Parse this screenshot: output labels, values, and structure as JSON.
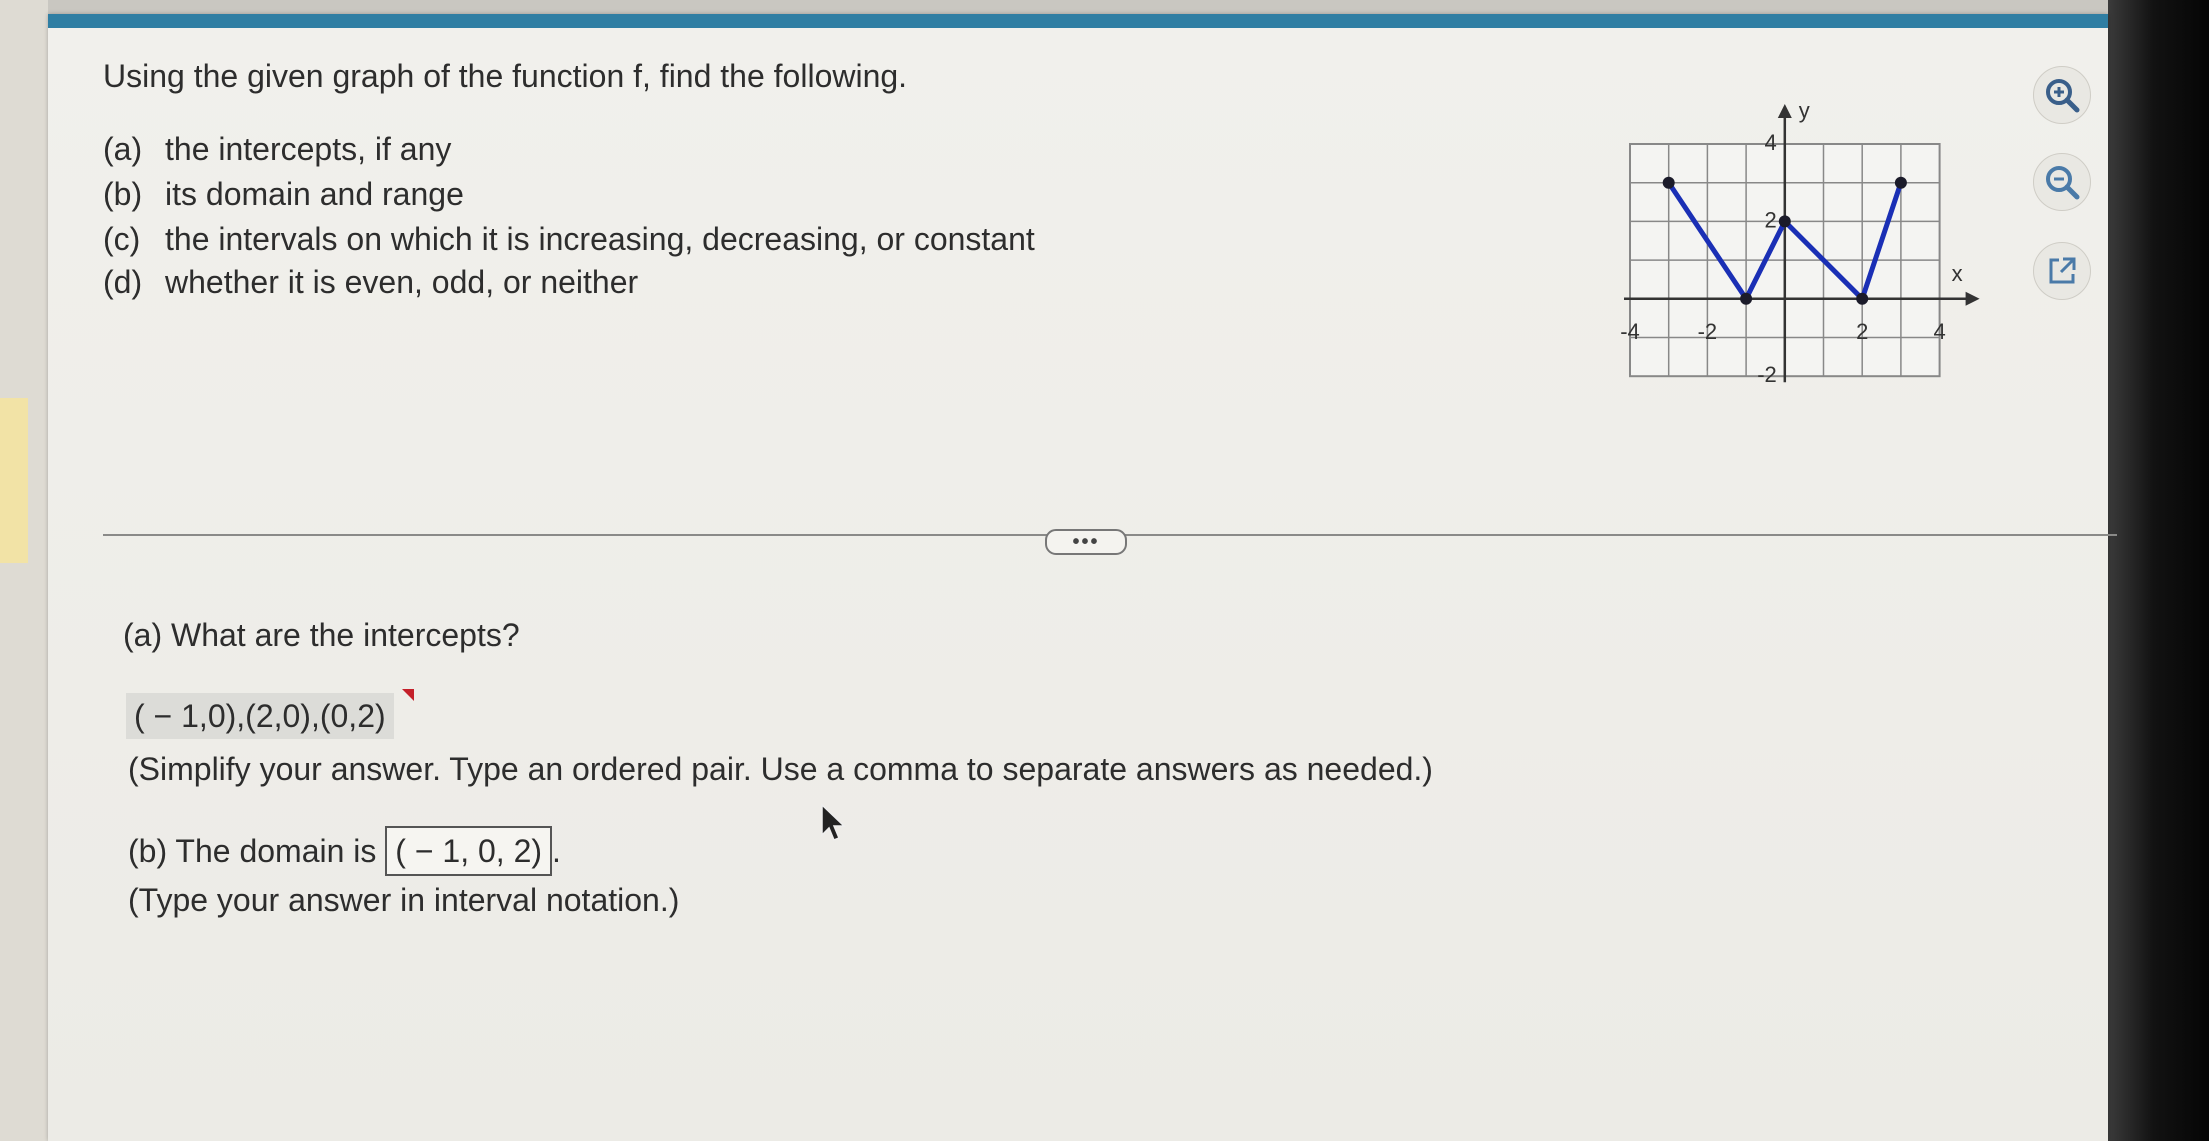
{
  "problem": {
    "title": "Using the given graph of the function f, find the following.",
    "parts": [
      {
        "tag": "(a)",
        "text": "the intercepts, if any"
      },
      {
        "tag": "(b)",
        "text": "its domain and range"
      },
      {
        "tag": "(c)",
        "text": "the intervals on which it is increasing, decreasing, or constant"
      },
      {
        "tag": "(d)",
        "text": "whether it is even, odd, or neither"
      }
    ]
  },
  "graph": {
    "x_axis_label": "x",
    "y_axis_label": "y",
    "x_ticks": [
      "-4",
      "-2",
      "2",
      "4"
    ],
    "y_ticks": [
      "4",
      "2",
      "-2"
    ],
    "line_color": "#1a2fb5"
  },
  "chart_data": {
    "type": "line",
    "x": [
      -3,
      -1,
      0,
      2,
      3
    ],
    "y": [
      3,
      0,
      2,
      0,
      3
    ],
    "xlim": [
      -4,
      4
    ],
    "ylim": [
      -2,
      4
    ],
    "grid": true
  },
  "toolbar": {
    "zoom_in": "zoom-in-icon",
    "zoom_out": "zoom-out-icon",
    "popout": "popout-icon"
  },
  "more_label": "•••",
  "answers": {
    "a_question": "(a) What are the intercepts?",
    "a_value": "( − 1,0),(2,0),(0,2)",
    "a_hint": "(Simplify your answer. Type an ordered pair. Use a comma to separate answers as needed.)",
    "b_prefix": "(b) The domain is",
    "b_value": "( − 1, 0, 2)",
    "b_suffix": ".",
    "b_hint": "(Type your answer in interval notation.)"
  }
}
